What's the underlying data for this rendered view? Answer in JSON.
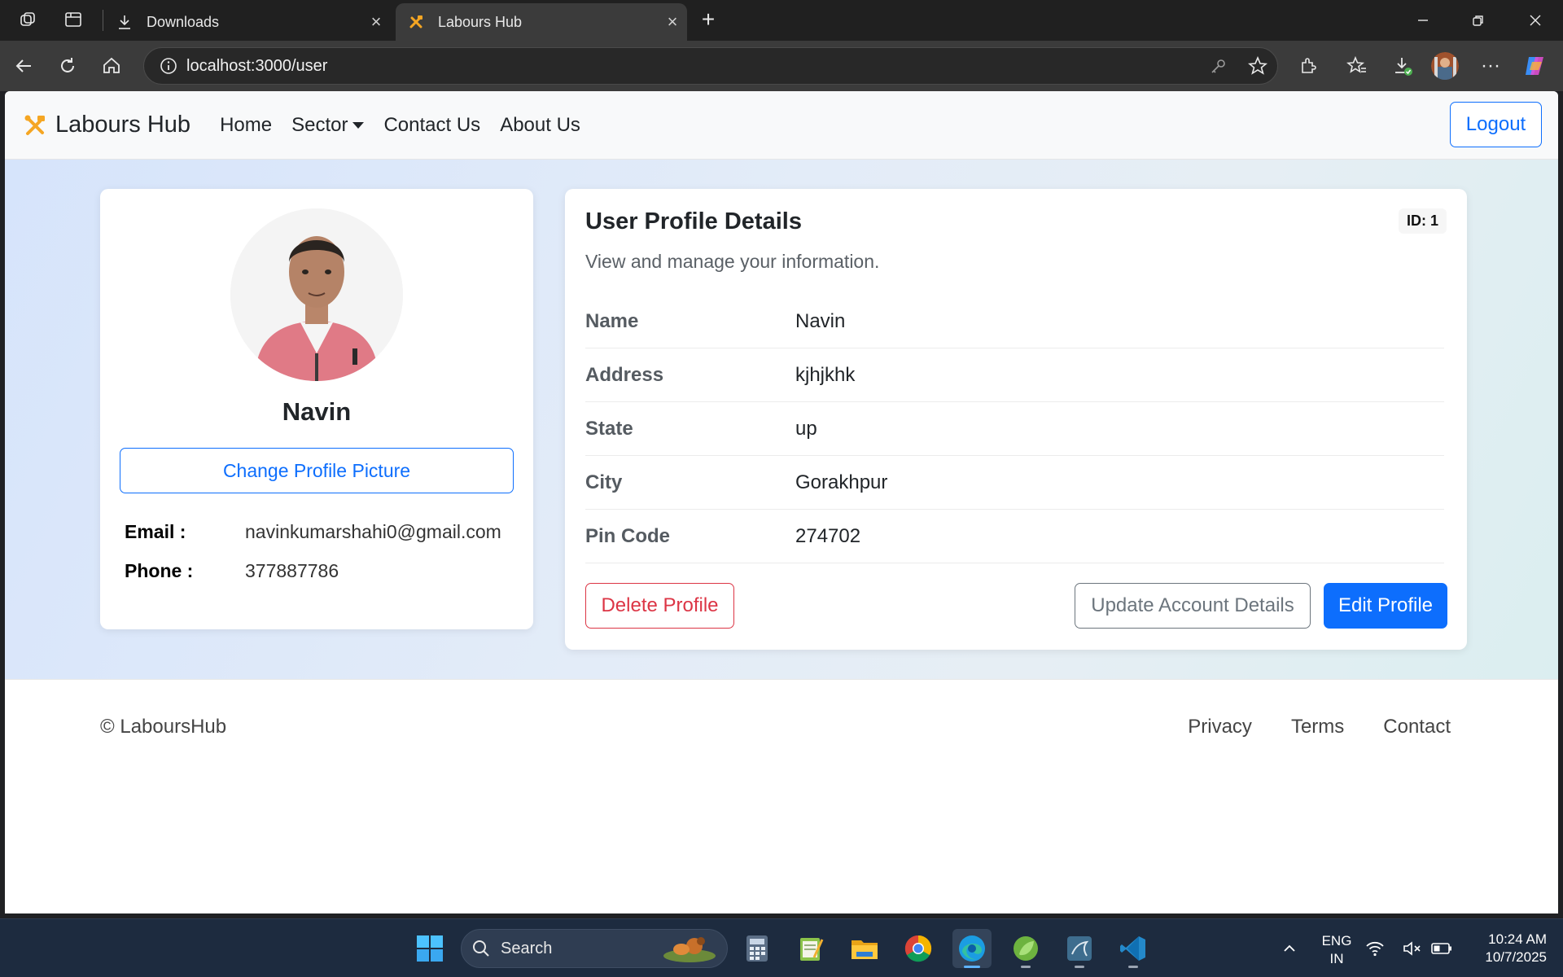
{
  "browser": {
    "tabs": [
      {
        "title": "Downloads",
        "active": false
      },
      {
        "title": "Labours Hub",
        "active": true
      }
    ],
    "url": "localhost:3000/user"
  },
  "navbar": {
    "brand": "Labours Hub",
    "links": {
      "home": "Home",
      "sector": "Sector",
      "contact": "Contact Us",
      "about": "About Us"
    },
    "logout": "Logout"
  },
  "profile_card": {
    "name": "Navin",
    "change_picture": "Change Profile Picture",
    "email_label": "Email :",
    "email": "navinkumarshahi0@gmail.com",
    "phone_label": "Phone :",
    "phone": "377887786"
  },
  "details": {
    "title": "User Profile Details",
    "subtitle": "View and manage your information.",
    "id_badge": "ID: 1",
    "rows": [
      {
        "label": "Name",
        "value": "Navin"
      },
      {
        "label": "Address",
        "value": "kjhjkhk"
      },
      {
        "label": "State",
        "value": "up"
      },
      {
        "label": "City",
        "value": "Gorakhpur"
      },
      {
        "label": "Pin Code",
        "value": "274702"
      }
    ],
    "buttons": {
      "delete": "Delete Profile",
      "update": "Update Account Details",
      "edit": "Edit Profile"
    }
  },
  "footer": {
    "copyright": "© LaboursHub",
    "links": {
      "privacy": "Privacy",
      "terms": "Terms",
      "contact": "Contact"
    }
  },
  "taskbar": {
    "search": "Search",
    "lang_line1": "ENG",
    "lang_line2": "IN",
    "time": "10:24 AM",
    "date": "10/7/2025"
  },
  "colors": {
    "primary": "#0d6efd",
    "danger": "#dc3545",
    "secondary": "#6c757d",
    "brand_icon": "#f5a623"
  }
}
